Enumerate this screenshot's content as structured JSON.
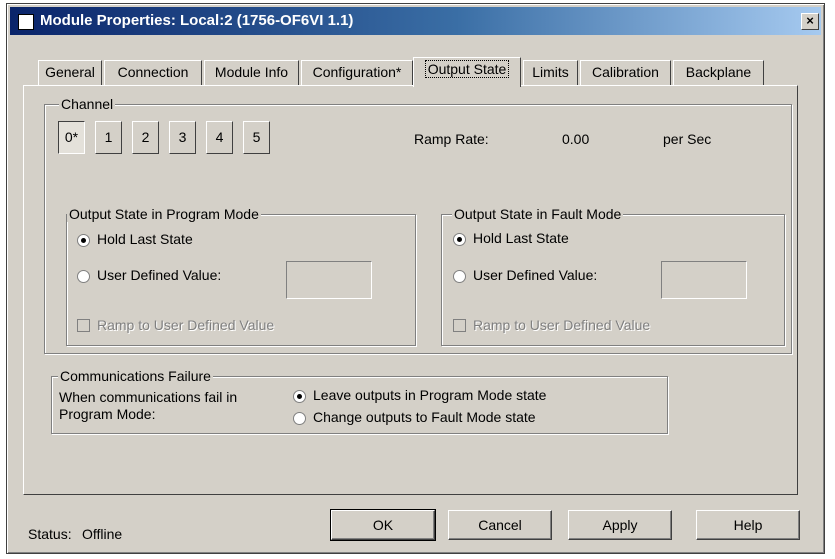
{
  "window": {
    "title": "Module Properties: Local:2 (1756-OF6VI 1.1)",
    "close_glyph": "×"
  },
  "tabs": [
    {
      "label": "General"
    },
    {
      "label": "Connection"
    },
    {
      "label": "Module Info"
    },
    {
      "label": "Configuration*"
    },
    {
      "label": "Output State",
      "active": true
    },
    {
      "label": "Limits"
    },
    {
      "label": "Calibration"
    },
    {
      "label": "Backplane"
    }
  ],
  "channel": {
    "legend": "Channel",
    "buttons": [
      "0*",
      "1",
      "2",
      "3",
      "4",
      "5"
    ],
    "selected": "0*",
    "ramp_rate_label": "Ramp Rate:",
    "ramp_rate_value": "0.00",
    "ramp_rate_unit": "per Sec"
  },
  "program_mode": {
    "legend": "Output State in Program Mode",
    "hold_last_state": "Hold Last State",
    "user_defined_value": "User Defined Value:",
    "ramp_label": "Ramp to User Defined Value",
    "selected": "hold_last_state",
    "value": ""
  },
  "fault_mode": {
    "legend": "Output State in Fault Mode",
    "hold_last_state": "Hold Last State",
    "user_defined_value": "User Defined Value:",
    "ramp_label": "Ramp to User Defined Value",
    "selected": "hold_last_state",
    "value": ""
  },
  "comm_failure": {
    "legend": "Communications Failure",
    "description_line1": "When communications fail in",
    "description_line2": "Program Mode:",
    "option_leave": "Leave outputs in Program Mode state",
    "option_change": "Change outputs to Fault Mode state",
    "selected": "leave"
  },
  "status": {
    "label": "Status:",
    "value": "Offline"
  },
  "buttons": {
    "ok": "OK",
    "cancel": "Cancel",
    "apply": "Apply",
    "help": "Help"
  },
  "colors": {
    "dialog_face": "#d4d0c8",
    "title_start": "#0a246a",
    "title_end": "#a6caf0"
  }
}
